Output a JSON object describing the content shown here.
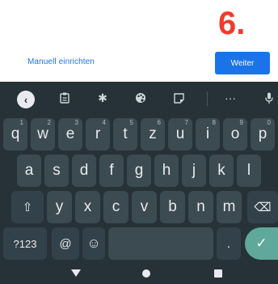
{
  "step_badge": "6.",
  "setup": {
    "manual_link": "Manuell einrichten",
    "next_button": "Weiter"
  },
  "keyboard": {
    "toolbar": [
      "back-chevron-icon",
      "clipboard-icon",
      "settings-gear-icon",
      "palette-icon",
      "sticker-icon",
      "more-dots-icon",
      "microphone-icon"
    ],
    "row1": [
      {
        "key": "q",
        "hint": "1"
      },
      {
        "key": "w",
        "hint": "2"
      },
      {
        "key": "e",
        "hint": "3"
      },
      {
        "key": "r",
        "hint": "4"
      },
      {
        "key": "t",
        "hint": "5"
      },
      {
        "key": "z",
        "hint": "6"
      },
      {
        "key": "u",
        "hint": "7"
      },
      {
        "key": "i",
        "hint": "8"
      },
      {
        "key": "o",
        "hint": "9"
      },
      {
        "key": "p",
        "hint": "0"
      }
    ],
    "row2": [
      "a",
      "s",
      "d",
      "f",
      "g",
      "h",
      "j",
      "k",
      "l"
    ],
    "row3": [
      "y",
      "x",
      "c",
      "v",
      "b",
      "n",
      "m"
    ],
    "row4": {
      "symbols": "?123",
      "at": "@",
      "emoji": "☺",
      "period": ".",
      "enter": "✓"
    },
    "shift_glyph": "⇧",
    "backspace_glyph": "⌫"
  },
  "colors": {
    "accent": "#1a73e8",
    "badge": "#f23a2b",
    "keyboard_bg": "#263238",
    "key_bg": "#3c4a52",
    "enter_bg": "#5fa89b"
  }
}
